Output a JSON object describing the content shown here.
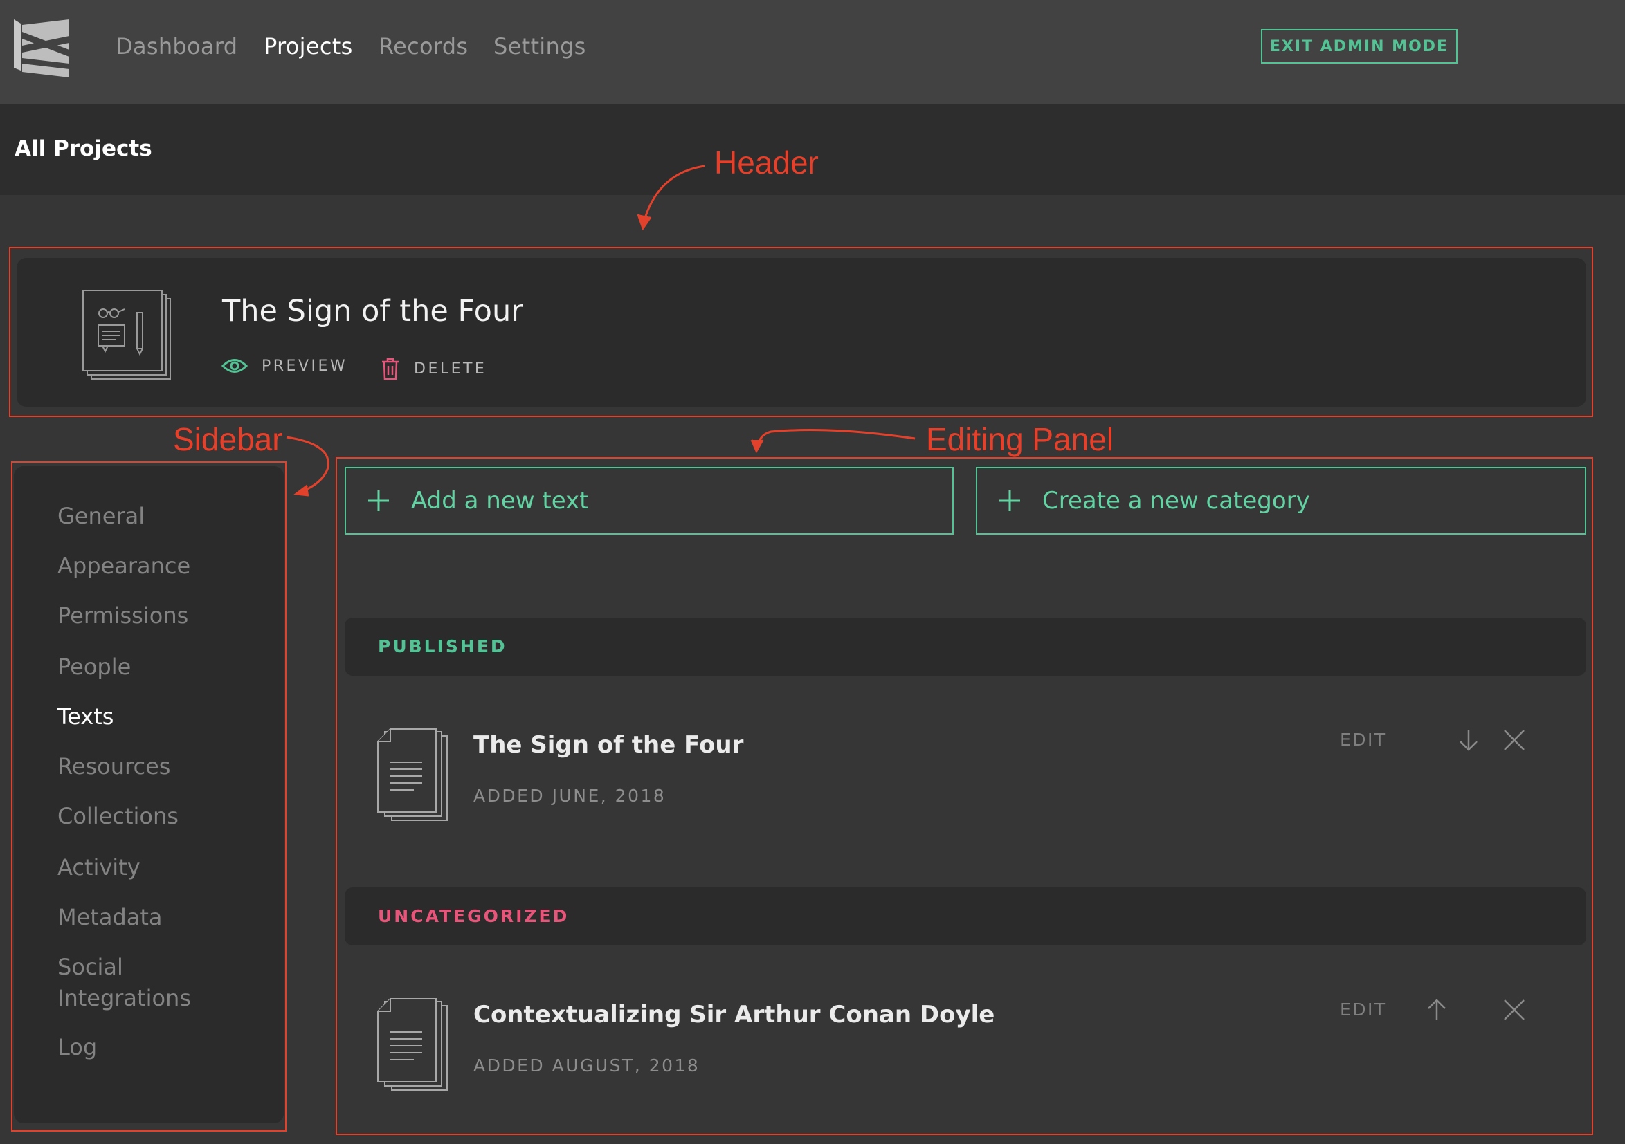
{
  "nav": {
    "items": [
      {
        "label": "Dashboard",
        "active": false
      },
      {
        "label": "Projects",
        "active": true
      },
      {
        "label": "Records",
        "active": false
      },
      {
        "label": "Settings",
        "active": false
      }
    ],
    "exit_admin_label": "EXIT ADMIN MODE"
  },
  "breadcrumb": "All Projects",
  "project": {
    "title": "The Sign of the Four",
    "preview_label": "PREVIEW",
    "delete_label": "DELETE"
  },
  "sidebar": {
    "items": [
      {
        "label": "General"
      },
      {
        "label": "Appearance"
      },
      {
        "label": "Permissions"
      },
      {
        "label": "People"
      },
      {
        "label": "Texts",
        "active": true
      },
      {
        "label": "Resources"
      },
      {
        "label": "Collections"
      },
      {
        "label": "Activity"
      },
      {
        "label": "Metadata"
      },
      {
        "label": "Social Integrations"
      },
      {
        "label": "Log"
      }
    ]
  },
  "panel": {
    "add_text_label": "Add a new text",
    "create_category_label": "Create a new category",
    "categories": [
      {
        "label": "PUBLISHED",
        "color": "#52c394",
        "texts": [
          {
            "title": "The Sign of the Four",
            "date": "ADDED JUNE, 2018",
            "edit_label": "EDIT",
            "move_direction": "down"
          }
        ]
      },
      {
        "label": "UNCATEGORIZED",
        "color": "#e8557a",
        "texts": [
          {
            "title": "Contextualizing Sir Arthur Conan Doyle",
            "date": "ADDED AUGUST, 2018",
            "edit_label": "EDIT",
            "move_direction": "up"
          }
        ]
      }
    ]
  },
  "annotations": {
    "header": "Header",
    "sidebar": "Sidebar",
    "editing_panel": "Editing Panel",
    "color": "#e2422c"
  },
  "colors": {
    "accent": "#52c394",
    "danger": "#e8557a",
    "nav_bg": "#424243",
    "page_bg": "#363636",
    "card_bg": "#2b2b2c"
  }
}
